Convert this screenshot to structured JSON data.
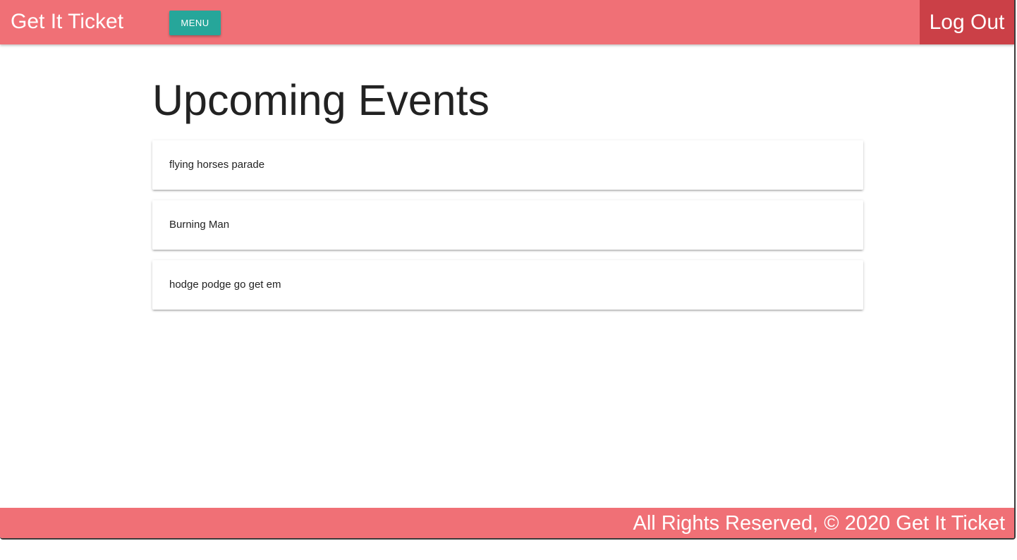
{
  "navbar": {
    "brand": "Get It Ticket",
    "menu_label": "MENU",
    "logout_label": "Log Out"
  },
  "main": {
    "title": "Upcoming Events",
    "events": [
      {
        "title": "flying horses parade"
      },
      {
        "title": "Burning Man"
      },
      {
        "title": "hodge podge go get em"
      }
    ]
  },
  "footer": {
    "text": "All Rights Reserved, © 2020 Get It Ticket"
  },
  "colors": {
    "navbar_bg": "#f07076",
    "logout_bg": "#cb4047",
    "menu_button_bg": "#26a69a",
    "footer_bg": "#f07076"
  }
}
